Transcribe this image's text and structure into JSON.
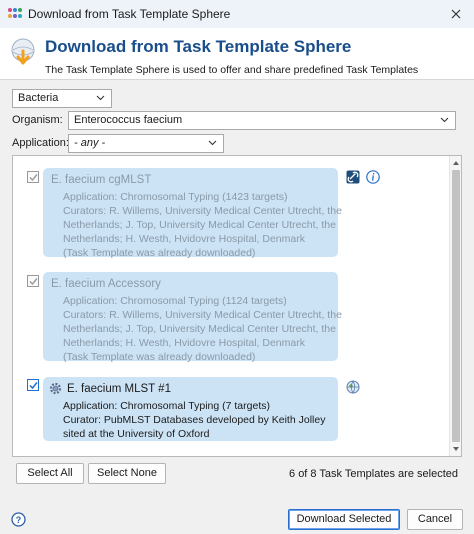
{
  "window": {
    "title": "Download from Task Template Sphere"
  },
  "header": {
    "title": "Download from Task Template Sphere",
    "subtitle": "The Task Template Sphere is used to offer and share predefined Task Templates"
  },
  "filters": {
    "category": "Bacteria",
    "organism_label": "Organism:",
    "organism": "Enterococcus faecium",
    "application_label": "Application:",
    "application": "- any -"
  },
  "templates": [
    {
      "name": "E. faecium cgMLST",
      "lines": [
        "Application: Chromosomal Typing (1423 targets)",
        "Curators: R. Willems, University Medical Center Utrecht, the",
        "Netherlands; J. Top, University Medical Center Utrecht, the",
        "Netherlands; H. Westh, Hvidovre Hospital, Denmark",
        "(Task Template was already downloaded)"
      ],
      "checked": true,
      "enabled": false
    },
    {
      "name": "E. faecium Accessory",
      "lines": [
        "Application: Chromosomal Typing (1124 targets)",
        "Curators: R. Willems, University Medical Center Utrecht, the",
        "Netherlands; J. Top, University Medical Center Utrecht, the",
        "Netherlands; H. Westh, Hvidovre Hospital, Denmark",
        "(Task Template was already downloaded)"
      ],
      "checked": true,
      "enabled": false
    },
    {
      "name": "E. faecium MLST #1",
      "lines": [
        "Application: Chromosomal Typing (7 targets)",
        "Curator: PubMLST Databases developed by Keith Jolley",
        "sited at the University of Oxford"
      ],
      "checked": true,
      "enabled": true
    }
  ],
  "buttons": {
    "select_all": "Select All",
    "select_none": "Select None",
    "download": "Download Selected",
    "cancel": "Cancel"
  },
  "status": "6 of 8 Task Templates are selected",
  "icons": {
    "app": "app-dots-icon",
    "header": "download-sphere-icon",
    "info": "info-icon",
    "link": "chain-link-icon",
    "globe": "globe-icon",
    "gear": "gear-icon",
    "help": "help-icon"
  },
  "colors": {
    "accent": "#1a4e8a",
    "card": "#cce3f6",
    "primary_border": "#2a6fd0"
  }
}
